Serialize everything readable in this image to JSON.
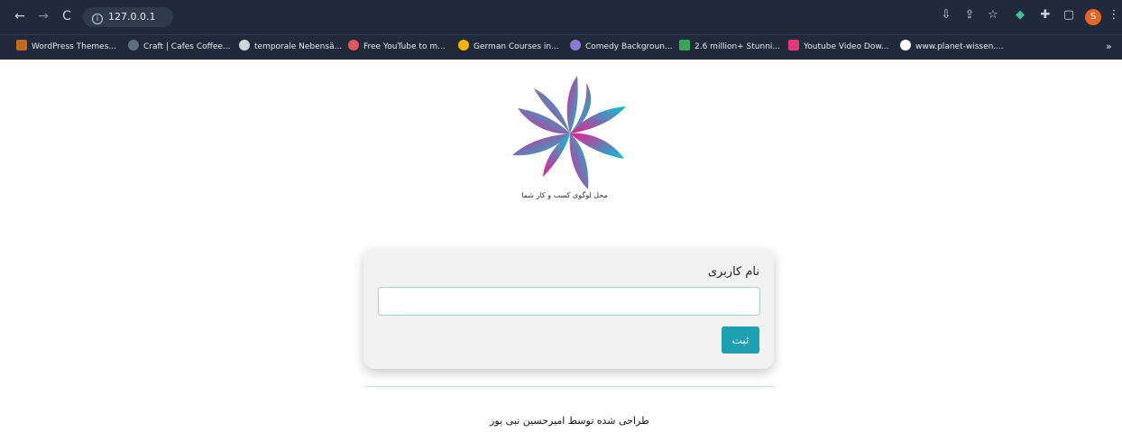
{
  "browser": {
    "url": "127.0.0.1",
    "bookmarks": [
      {
        "label": "WordPress Themes...",
        "color": "#c36b1c"
      },
      {
        "label": "Craft | Cafes Coffee...",
        "color": "#5f6f7f"
      },
      {
        "label": "temporale Nebensä...",
        "color": "#cfd6df"
      },
      {
        "label": "Free YouTube to m...",
        "color": "#e0585b"
      },
      {
        "label": "German Courses in...",
        "color": "#f4b400"
      },
      {
        "label": "Comedy Backgroun...",
        "color": "#8a7cd3"
      },
      {
        "label": "2.6 million+ Stunni...",
        "color": "#3aa655"
      },
      {
        "label": "Youtube Video Dow...",
        "color": "#e6367a"
      },
      {
        "label": "www.planet-wissen....",
        "color": "#ffffff"
      }
    ],
    "more_label": "»",
    "profile_initial": "S"
  },
  "logo": {
    "caption": "محل لوگوی کسب و کار شما",
    "colors": [
      "#e91e8c",
      "#00c6d7"
    ]
  },
  "form": {
    "label": "نام کاربری",
    "input_value": "",
    "submit_label": "ثبت"
  },
  "footer": {
    "text": "طراحی شده توسط امیرحسین نبی پور"
  }
}
